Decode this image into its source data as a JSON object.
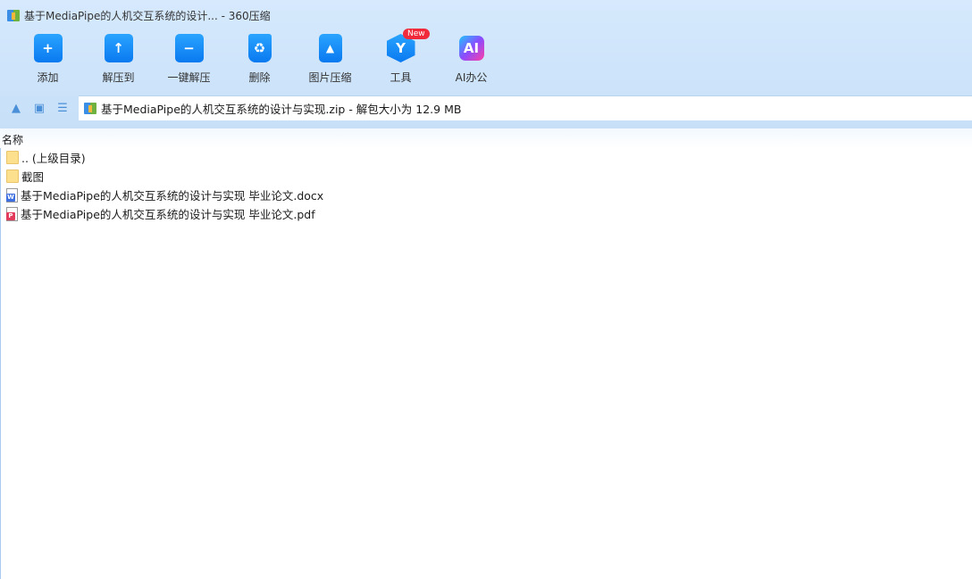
{
  "window": {
    "title": "基于MediaPipe的人机交互系统的设计... - 360压缩"
  },
  "toolbar": {
    "items": [
      {
        "label": "添加",
        "icon": "add-folder-icon",
        "glyph": "+"
      },
      {
        "label": "解压到",
        "icon": "extract-to-icon",
        "glyph": "↑"
      },
      {
        "label": "一键解压",
        "icon": "one-click-extract-icon",
        "glyph": "−"
      },
      {
        "label": "删除",
        "icon": "delete-bin-icon",
        "glyph": "♻"
      },
      {
        "label": "图片压缩",
        "icon": "image-compress-icon",
        "glyph": "▲"
      },
      {
        "label": "工具",
        "icon": "tools-icon",
        "glyph": "Y",
        "badge": "New"
      },
      {
        "label": "AI办公",
        "icon": "ai-office-icon",
        "glyph": "AI"
      }
    ]
  },
  "address": {
    "text": "基于MediaPipe的人机交互系统的设计与实现.zip - 解包大小为 12.9 MB"
  },
  "list": {
    "header": "名称",
    "items": [
      {
        "name": ".. (上级目录)",
        "type": "folder"
      },
      {
        "name": "截图",
        "type": "folder"
      },
      {
        "name": "基于MediaPipe的人机交互系统的设计与实现 毕业论文.docx",
        "type": "docx",
        "badge": "W",
        "color": "#3d6fe0"
      },
      {
        "name": "基于MediaPipe的人机交互系统的设计与实现 毕业论文.pdf",
        "type": "pdf",
        "badge": "P",
        "color": "#e23a5a"
      }
    ]
  }
}
